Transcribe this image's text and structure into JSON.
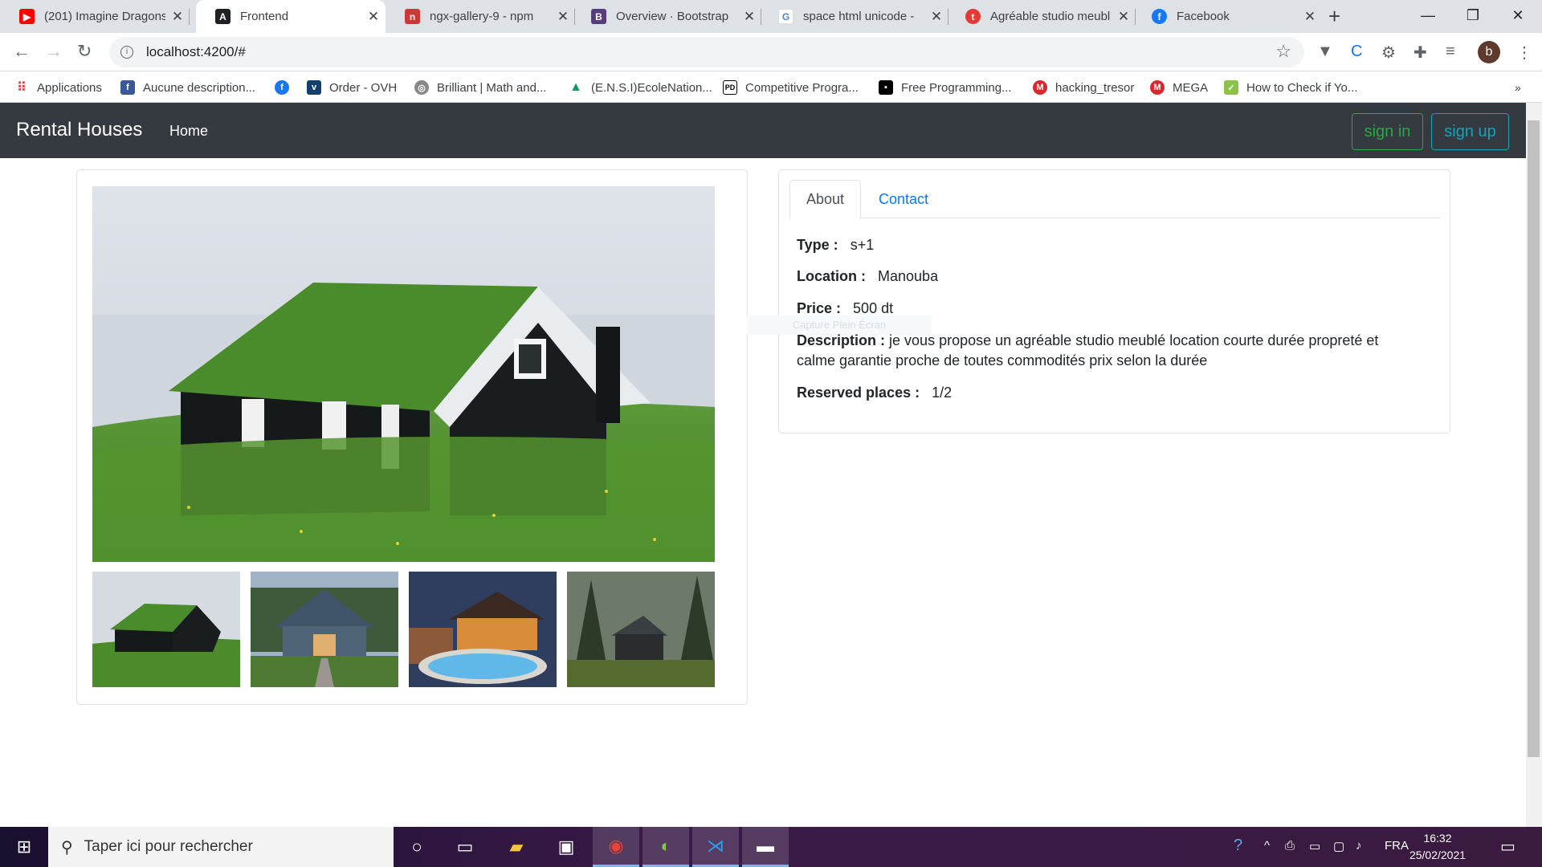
{
  "browser": {
    "tabs": [
      {
        "title": "(201) Imagine Dragons",
        "icon": "youtube-icon",
        "color": "#ff0000"
      },
      {
        "title": "Frontend",
        "icon": "angular-icon",
        "color": "#202124"
      },
      {
        "title": "ngx-gallery-9 - npm",
        "icon": "npm-icon",
        "color": "#cb3837"
      },
      {
        "title": "Overview · Bootstrap",
        "icon": "bootstrap-icon",
        "color": "#563d7c"
      },
      {
        "title": "space html unicode - ",
        "icon": "google-icon",
        "color": "#4285f4"
      },
      {
        "title": "Agréable studio meubl",
        "icon": "tayara-icon",
        "color": "#e53935"
      },
      {
        "title": "Facebook",
        "icon": "facebook-icon",
        "color": "#1877f2"
      }
    ],
    "url": "localhost:4200/#",
    "profile_initial": "b",
    "bookmarks": [
      {
        "label": "Applications"
      },
      {
        "label": "Aucune description..."
      },
      {
        "label": ""
      },
      {
        "label": "Order - OVH"
      },
      {
        "label": "Brilliant | Math and..."
      },
      {
        "label": "(E.N.S.I)EcoleNation..."
      },
      {
        "label": "Competitive Progra..."
      },
      {
        "label": "Free Programming..."
      },
      {
        "label": "hacking_tresor"
      },
      {
        "label": "MEGA"
      },
      {
        "label": "How to Check if Yo..."
      }
    ]
  },
  "app": {
    "brand": "Rental Houses",
    "nav_home": "Home",
    "sign_in": "sign in",
    "sign_up": "sign up"
  },
  "details": {
    "tabs": {
      "about": "About",
      "contact": "Contact"
    },
    "type_label": "Type :",
    "type_value": "s+1",
    "location_label": "Location :",
    "location_value": "Manouba",
    "price_label": "Price :",
    "price_value": "500 dt",
    "description_label": "Description :",
    "description_value": "je vous propose un agréable studio meublé location courte durée propreté et calme garantie proche de toutes commodités prix selon la durée",
    "reserved_label": "Reserved places :",
    "reserved_value": "1/2",
    "ghost_tooltip": "Capture Plein Écran"
  },
  "taskbar": {
    "search_placeholder": "Taper ici pour rechercher",
    "language": "FRA",
    "time": "16:32",
    "date": "25/02/2021"
  }
}
